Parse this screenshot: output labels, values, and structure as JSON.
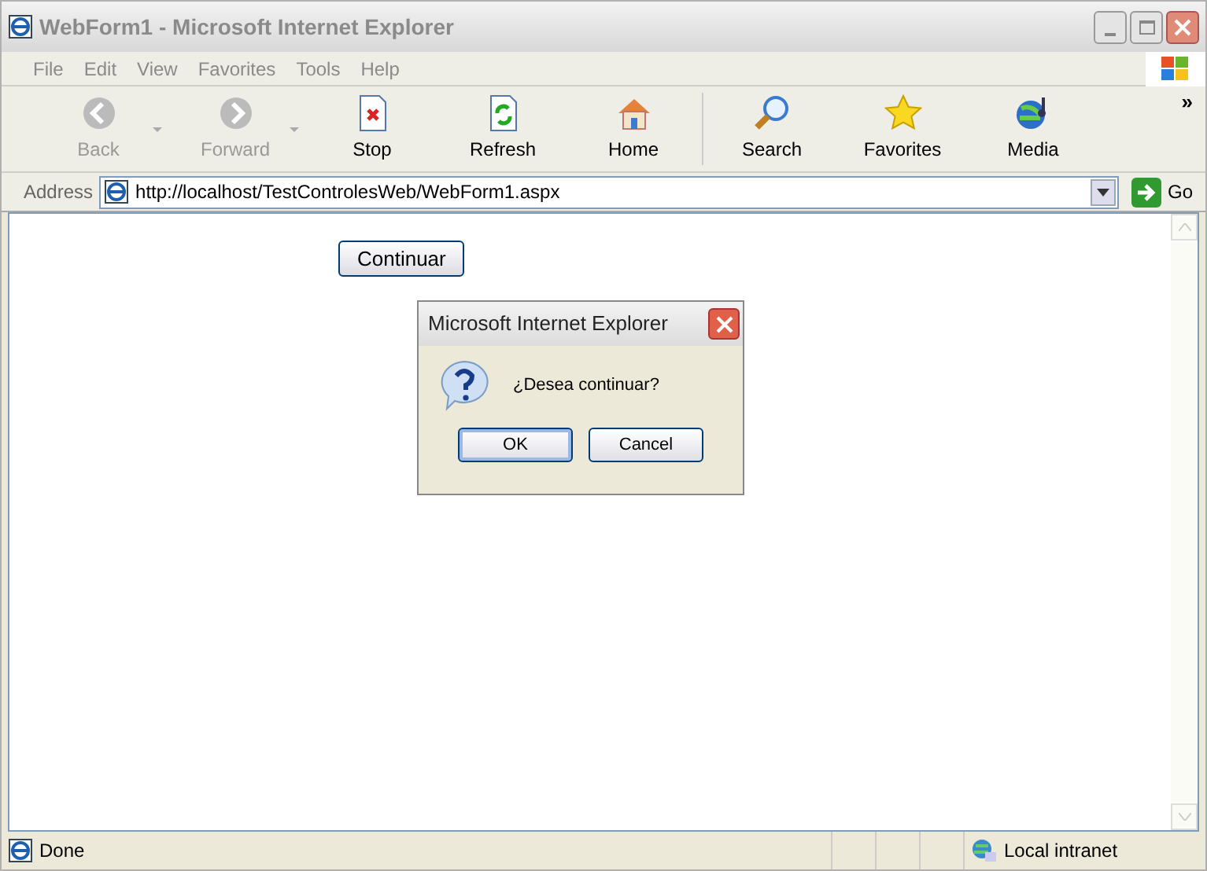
{
  "window": {
    "title": "WebForm1 - Microsoft Internet Explorer"
  },
  "menu": [
    "File",
    "Edit",
    "View",
    "Favorites",
    "Tools",
    "Help"
  ],
  "toolbar": [
    {
      "label": "Back",
      "kind": "back",
      "disabled": true,
      "dropdown": true
    },
    {
      "label": "Forward",
      "kind": "forward",
      "disabled": true,
      "dropdown": true
    },
    {
      "label": "Stop",
      "kind": "stop",
      "disabled": false,
      "dropdown": false
    },
    {
      "label": "Refresh",
      "kind": "refresh",
      "disabled": false,
      "dropdown": false
    },
    {
      "label": "Home",
      "kind": "home",
      "disabled": false,
      "dropdown": false
    },
    {
      "label": "Search",
      "kind": "search",
      "disabled": false,
      "dropdown": false
    },
    {
      "label": "Favorites",
      "kind": "favorites",
      "disabled": false,
      "dropdown": false
    },
    {
      "label": "Media",
      "kind": "media",
      "disabled": false,
      "dropdown": false
    }
  ],
  "toolbar_overflow": "»",
  "address_bar": {
    "label": "Address",
    "value": "http://localhost/TestControlesWeb/WebForm1.aspx",
    "go": "Go"
  },
  "page": {
    "button": "Continuar"
  },
  "dialog": {
    "title": "Microsoft Internet Explorer",
    "message": "¿Desea continuar?",
    "buttons": [
      {
        "label": "OK",
        "selected": true
      },
      {
        "label": "Cancel",
        "selected": false
      }
    ]
  },
  "status_bar": {
    "text": "Done",
    "zone": "Local intranet"
  }
}
